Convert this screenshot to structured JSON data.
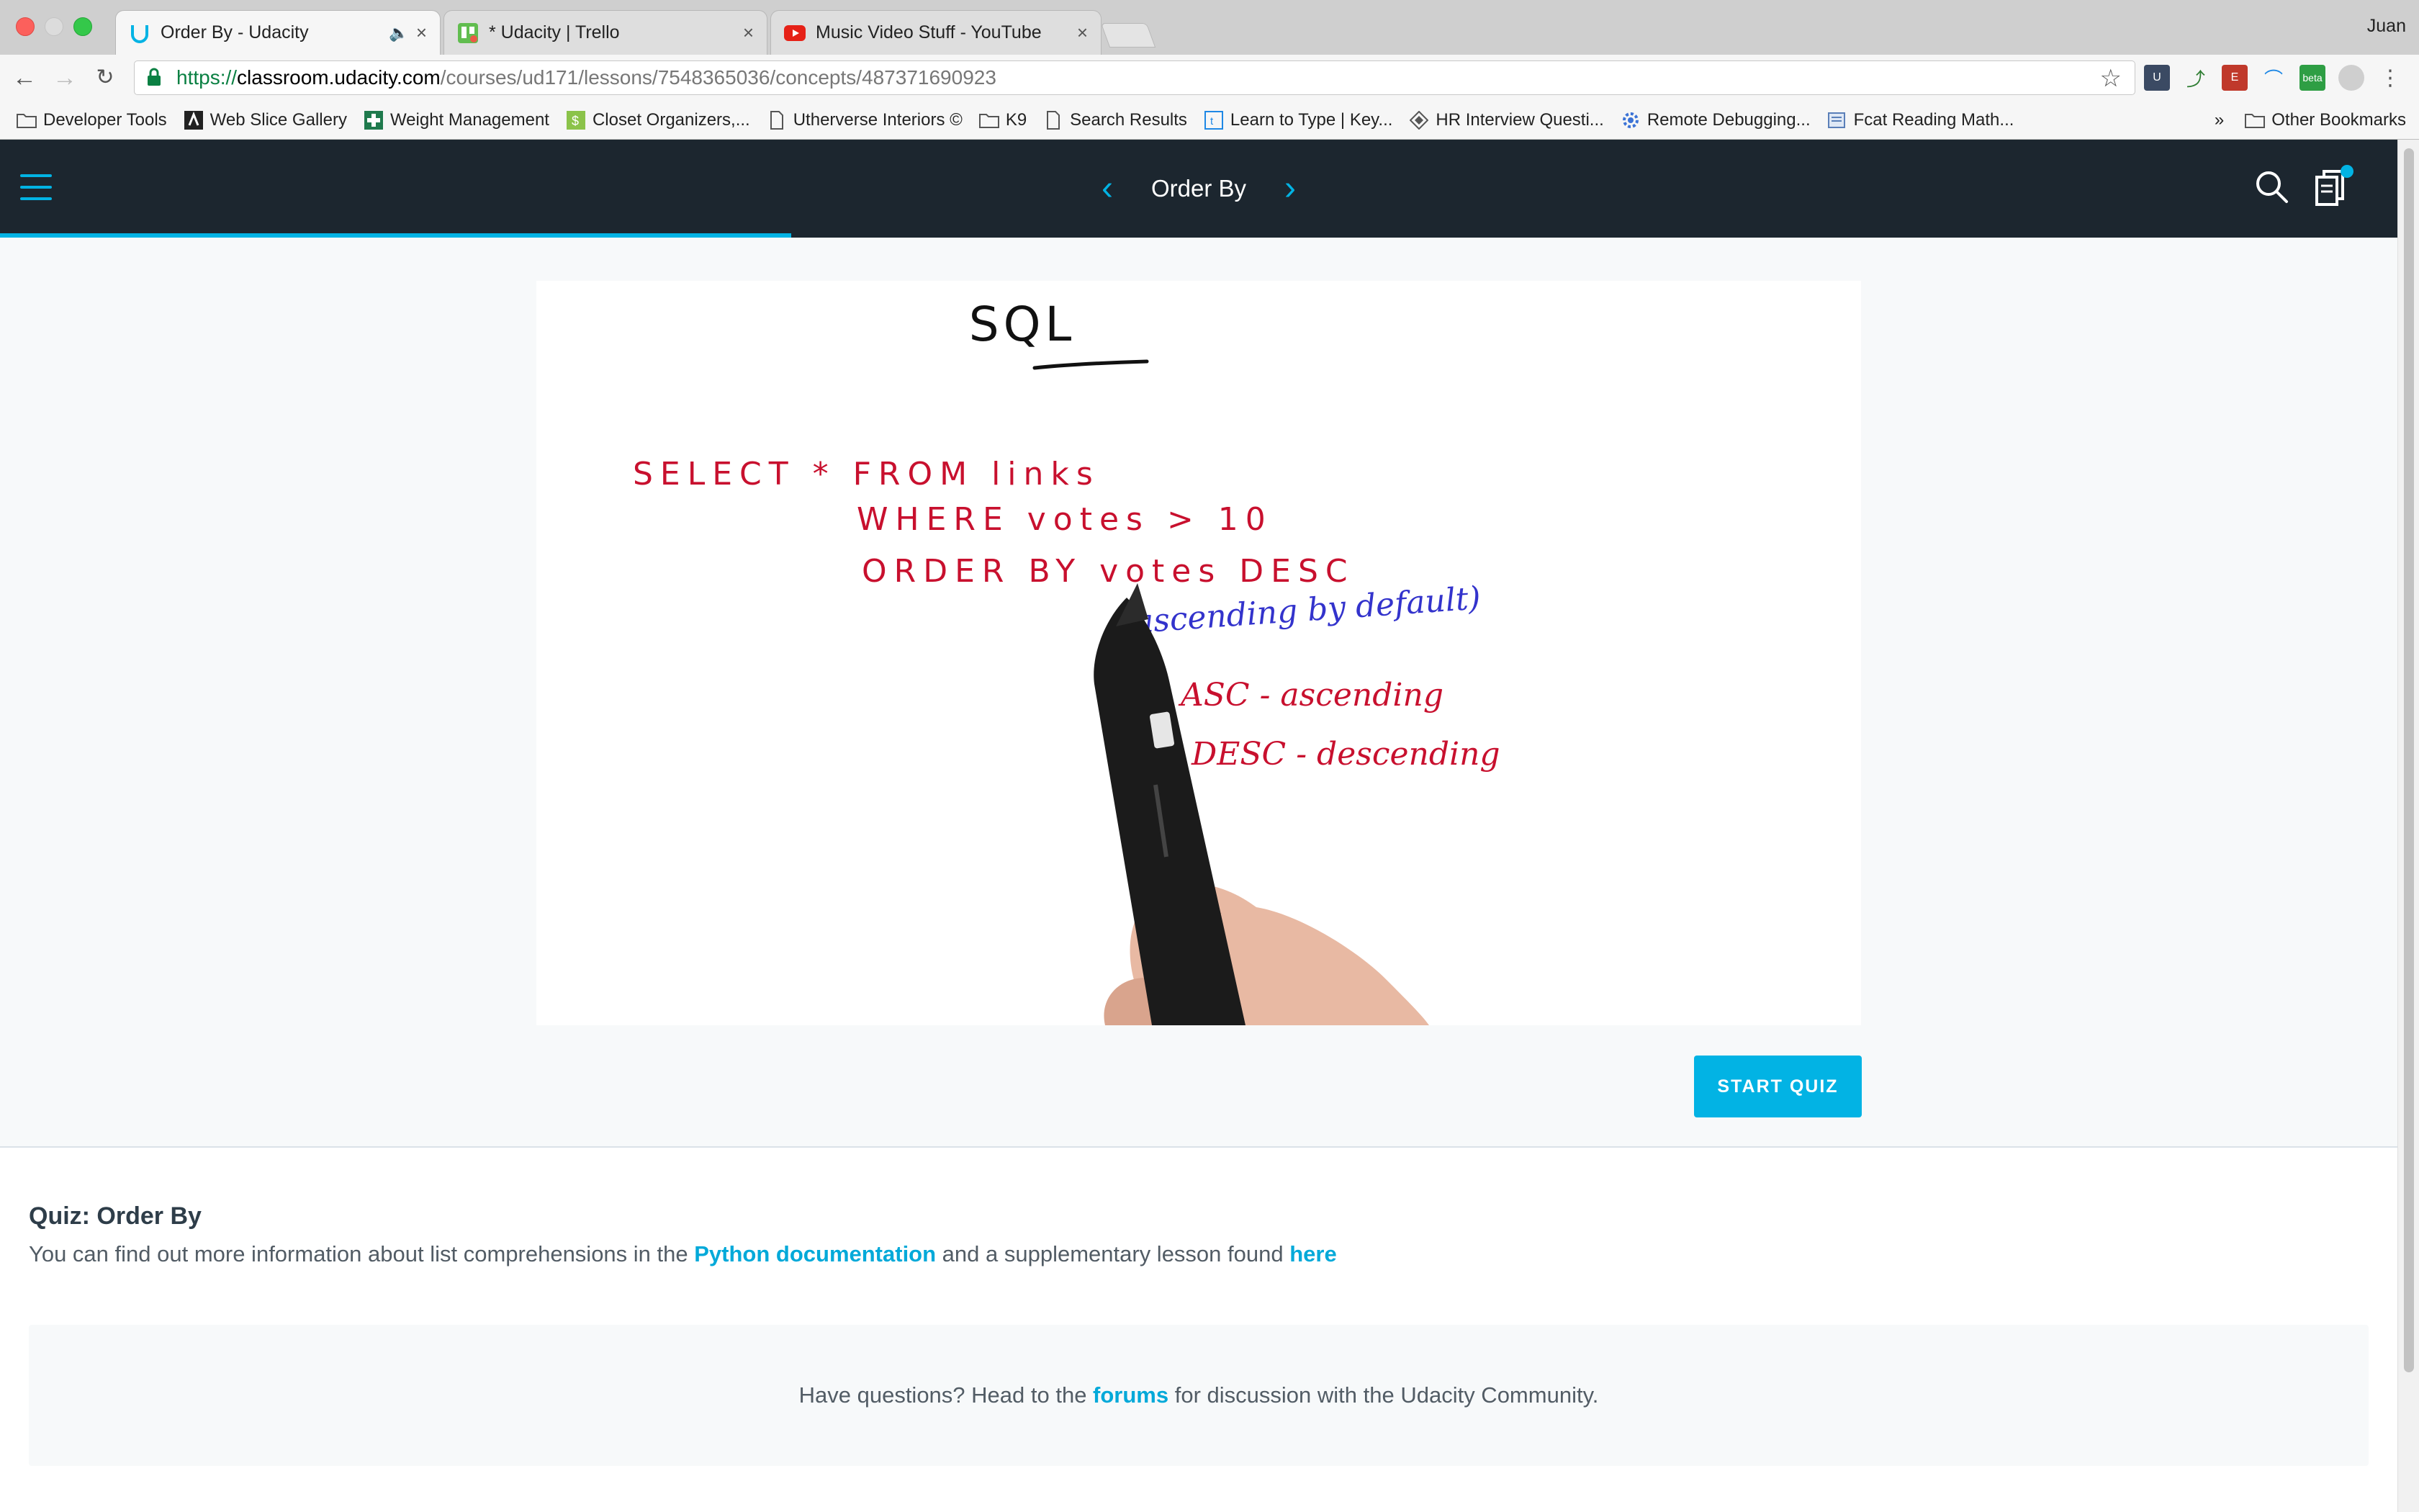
{
  "browser": {
    "profile_name": "Juan",
    "tabs": [
      {
        "title": "Order By - Udacity",
        "favicon": "udacity-icon",
        "active": true
      },
      {
        "title": "* Udacity | Trello",
        "favicon": "trello-icon",
        "active": false
      },
      {
        "title": "Music Video Stuff - YouTube",
        "favicon": "youtube-icon",
        "active": false
      }
    ],
    "url": {
      "scheme": "https://",
      "host": "classroom.udacity.com",
      "path": "/courses/ud171/lessons/7548365036/concepts/487371690923"
    },
    "bookmarks": [
      {
        "label": "Developer Tools",
        "icon": "folder-icon"
      },
      {
        "label": "Web Slice Gallery",
        "icon": "ie-icon"
      },
      {
        "label": "Weight Management",
        "icon": "health-icon"
      },
      {
        "label": "Closet Organizers,...",
        "icon": "dollar-icon"
      },
      {
        "label": "Utherverse Interiors ©",
        "icon": "page-icon"
      },
      {
        "label": "K9",
        "icon": "folder-icon"
      },
      {
        "label": "Search Results",
        "icon": "page-icon"
      },
      {
        "label": "Learn to Type | Key...",
        "icon": "typing-icon"
      },
      {
        "label": "HR Interview Questi...",
        "icon": "diamond-icon"
      },
      {
        "label": "Remote Debugging...",
        "icon": "gear-icon"
      },
      {
        "label": "Fcat Reading Math...",
        "icon": "doc-icon"
      }
    ],
    "bookmarks_overflow": "»",
    "other_bookmarks": "Other Bookmarks",
    "extension_badge": "beta"
  },
  "header": {
    "lesson_title": "Order By",
    "progress_percent": 33,
    "accent_color": "#02b3e4",
    "background_color": "#1c262f"
  },
  "video": {
    "heading": "SQL",
    "code_lines": [
      "SELECT * FROM links",
      "WHERE votes > 10",
      "ORDER BY votes DESC"
    ],
    "note": "(ascending by default)",
    "legend": [
      "ASC - ascending",
      "DESC - descending"
    ]
  },
  "actions": {
    "start_quiz": "START QUIZ"
  },
  "quiz": {
    "title": "Quiz: Order By",
    "desc_prefix": "You can find out more information about list comprehensions in the ",
    "doc_link": "Python documentation",
    "desc_middle": " and a supplementary lesson found ",
    "here_link": "here"
  },
  "forums": {
    "prefix": "Have questions? Head to the ",
    "link": "forums",
    "suffix": " for discussion with the Udacity Community."
  }
}
